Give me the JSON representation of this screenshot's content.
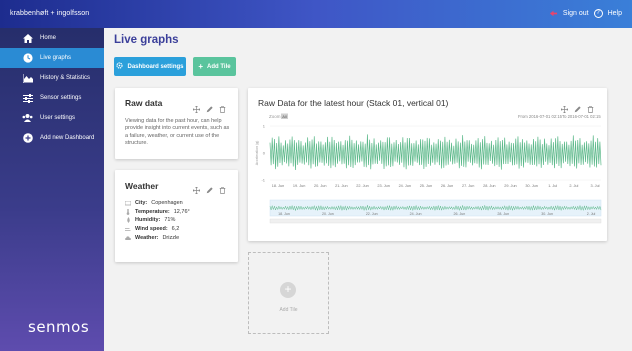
{
  "brand": "krabbenhøft + ingolfsson",
  "topbar": {
    "sign_out": "Sign out",
    "help": "Help"
  },
  "sidebar": {
    "items": [
      {
        "label": "Home",
        "icon": "home-icon",
        "active": false
      },
      {
        "label": "Live graphs",
        "icon": "clock-icon",
        "active": true
      },
      {
        "label": "History & Statistics",
        "icon": "area-chart-icon",
        "active": false
      },
      {
        "label": "Sensor settings",
        "icon": "sliders-icon",
        "active": false
      },
      {
        "label": "User settings",
        "icon": "users-icon",
        "active": false
      },
      {
        "label": "Add new Dashboard",
        "icon": "plus-circle-icon",
        "active": false
      }
    ],
    "logo": "senmos"
  },
  "main": {
    "title": "Live graphs",
    "dashboard_settings": "Dashboard settings",
    "add_tile": "Add Tile"
  },
  "raw_card": {
    "title": "Raw data",
    "body": "Viewing data for the past hour, can help provide insight into current events, such as a failure, weather, or current use of the structure."
  },
  "weather_card": {
    "title": "Weather",
    "rows": [
      {
        "label": "City:",
        "value": "Copenhagen",
        "icon": "flag-icon"
      },
      {
        "label": "Temperature:",
        "value": "12,76°",
        "icon": "thermometer-icon"
      },
      {
        "label": "Humidity:",
        "value": "71%",
        "icon": "droplet-icon"
      },
      {
        "label": "Wind speed:",
        "value": "6,2",
        "icon": "wind-icon"
      },
      {
        "label": "Weather:",
        "value": "Drizzle",
        "icon": "cloud-icon"
      }
    ]
  },
  "chart_card": {
    "title": "Raw Data for the latest hour (Stack 01, vertical 01)",
    "zoom_label": "Zoom",
    "zoom_value": "All",
    "from_label": "From",
    "from_value": "2016-07-01 02:15",
    "to_label": "To",
    "to_value": "2016-07-01 02:15"
  },
  "add_tile_placeholder": {
    "label": "Add Tile"
  },
  "colors": {
    "accent": "#2ba0db",
    "add_green": "#5ac49d",
    "title_purple": "#3b3f9a",
    "series": "#5cb98a",
    "sidebar_active": "#2a8bd4"
  },
  "chart_data": {
    "type": "line",
    "title": "",
    "ylabel": "Acceleration (g)",
    "xlabel": "",
    "ylim": [
      -1,
      1
    ],
    "yticks": [
      "1",
      "0",
      "-1"
    ],
    "x_ticks": [
      "18. Jun",
      "19. Jun",
      "20. Jun",
      "21. Jun",
      "22. Jun",
      "23. Jun",
      "24. Jun",
      "25. Jun",
      "26. Jun",
      "27. Jun",
      "28. Jun",
      "29. Jun",
      "30. Jun",
      "1. Jul",
      "2. Jul",
      "3. Jul"
    ],
    "navigator_ticks": [
      "18. Jun",
      "20. Jun",
      "22. Jun",
      "24. Jun",
      "26. Jun",
      "28. Jun",
      "30. Jun",
      "2. Jul"
    ],
    "series": [
      {
        "values": [
          0.45,
          -0.5,
          0.6,
          -0.42,
          0.52,
          -0.6,
          0.38,
          -0.55,
          0.7,
          -0.45,
          0.5,
          -0.62,
          0.4,
          -0.48,
          0.66,
          -0.52,
          0.44,
          -0.58,
          0.55,
          -0.4,
          0.62,
          -0.5,
          0.48,
          -0.65,
          0.42,
          -0.5,
          0.58,
          -0.46,
          0.6,
          -0.56,
          0.4,
          -0.6,
          0.52,
          -0.44,
          0.68,
          -0.5,
          0.46,
          -0.58,
          0.5,
          -0.42,
          0.64,
          -0.55,
          0.4,
          -0.6,
          0.56,
          -0.48,
          0.6,
          -0.52,
          0.44,
          -0.62,
          0.5,
          -0.45,
          0.66,
          -0.5,
          0.42,
          -0.56,
          0.6,
          -0.48,
          0.52,
          -0.6,
          0.45,
          -0.52,
          0.58,
          -0.44,
          0.62,
          -0.58,
          0.4,
          -0.5,
          0.56,
          -0.62,
          0.48,
          -0.46,
          0.64,
          -0.52,
          0.5,
          -0.6,
          0.42,
          -0.55,
          0.6,
          -0.48
        ]
      }
    ]
  }
}
